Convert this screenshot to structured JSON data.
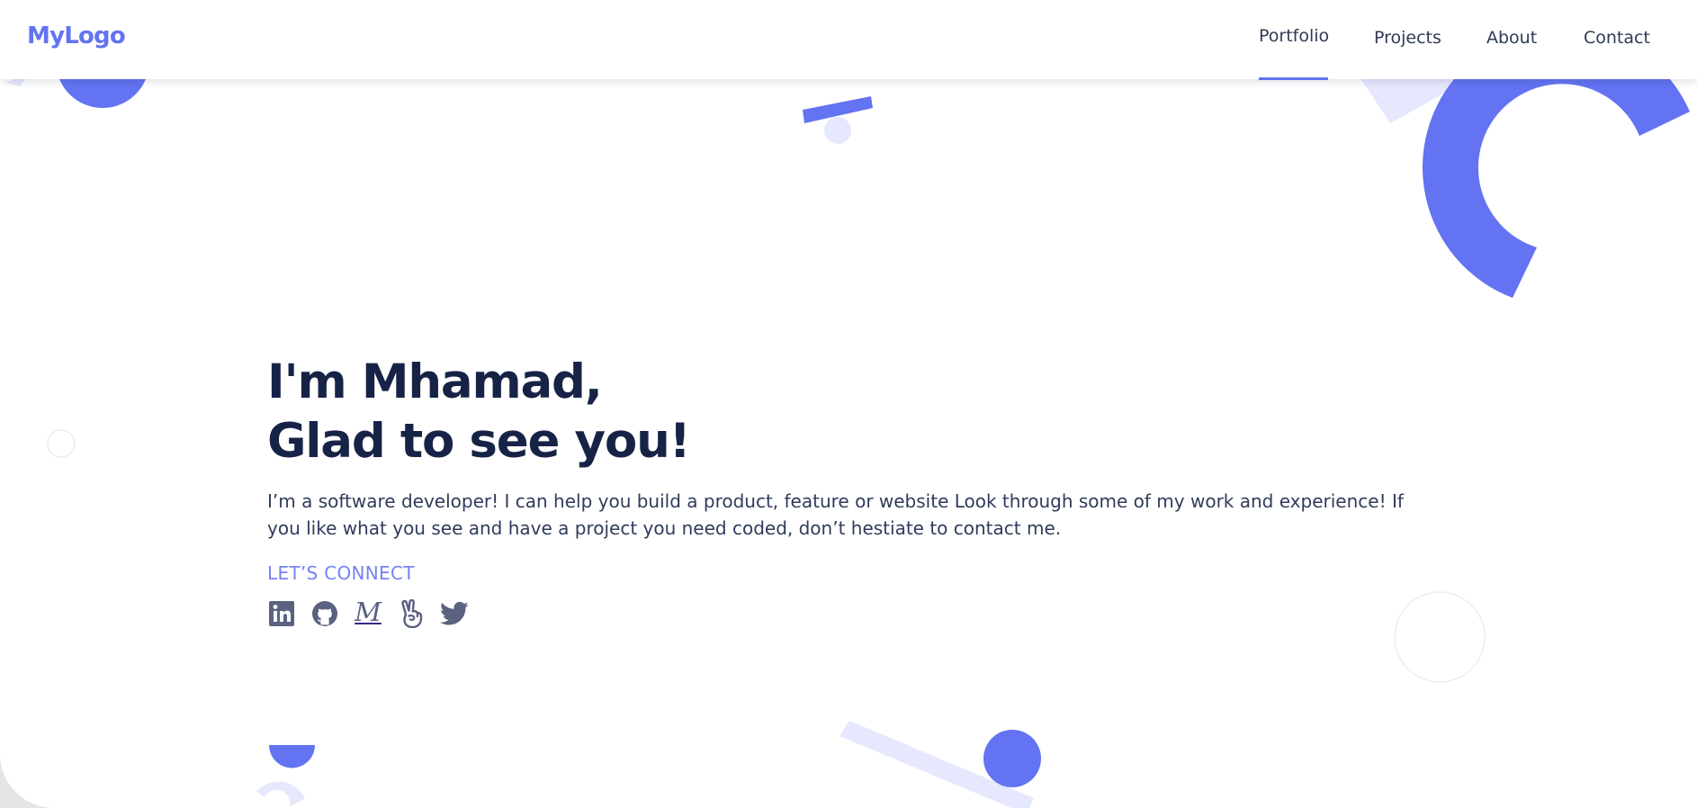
{
  "navbar": {
    "logo": "MyLogo",
    "links": [
      {
        "label": "Portfolio",
        "active": true
      },
      {
        "label": "Projects",
        "active": false
      },
      {
        "label": "About",
        "active": false
      },
      {
        "label": "Contact",
        "active": false
      }
    ]
  },
  "hero": {
    "title_line1": "I'm Mhamad,",
    "title_line2": "Glad to see you!",
    "description": "I’m a software developer! I can help you build a product, feature or website Look through some of my work and experience! If you like what you see and have a project you need coded, don’t hestiate to contact me.",
    "connect_label": "LET’S CONNECT",
    "socials": [
      {
        "icon": "linkedin-icon"
      },
      {
        "icon": "github-icon"
      },
      {
        "icon": "medium-icon",
        "glyph": "M"
      },
      {
        "icon": "peace-hand-icon"
      },
      {
        "icon": "twitter-icon"
      }
    ]
  },
  "colors": {
    "accent": "#6373f2",
    "accent_light": "#e6e8fd",
    "heading": "#172346",
    "body_text": "#303c5c",
    "icon": "#5a6280"
  }
}
